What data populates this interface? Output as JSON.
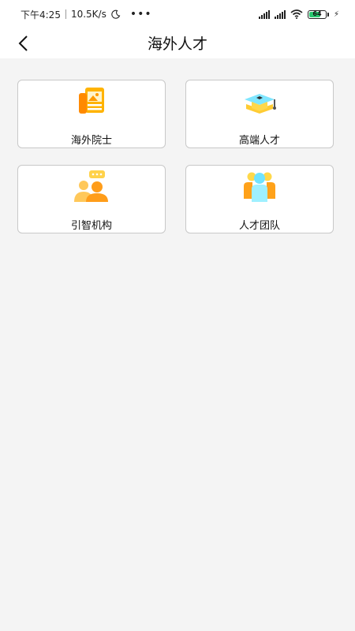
{
  "status_bar": {
    "time": "下午4:25",
    "network_speed": "10.5K/s",
    "battery_level": "64"
  },
  "header": {
    "title": "海外人才"
  },
  "cards": [
    {
      "label": "海外院士",
      "icon": "newspaper-icon"
    },
    {
      "label": "高端人才",
      "icon": "graduation-cap-icon"
    },
    {
      "label": "引智机构",
      "icon": "people-chat-icon"
    },
    {
      "label": "人才团队",
      "icon": "team-icon"
    }
  ],
  "colors": {
    "accent_orange": "#ff9a00",
    "accent_yellow": "#ffd84a",
    "accent_teal": "#6fe3ff",
    "battery_green": "#28c76f"
  }
}
